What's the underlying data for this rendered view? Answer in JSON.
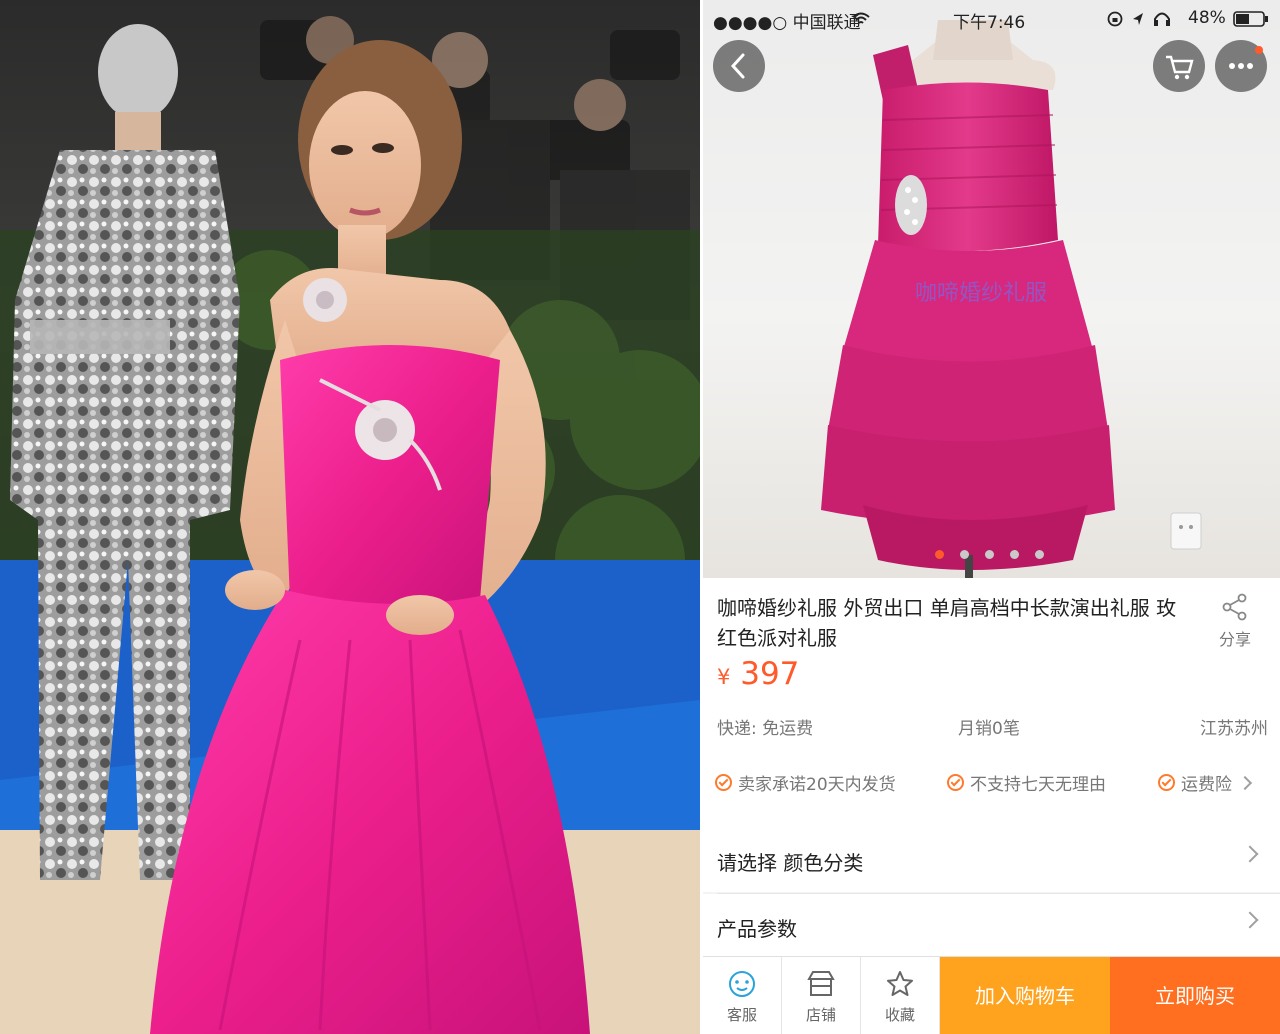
{
  "status_bar": {
    "carrier": "●●●●○ 中国联通",
    "time": "下午7:46",
    "battery": "48%",
    "icons": [
      "wifi-icon",
      "lock-rotation-icon",
      "location-icon",
      "headphones-icon",
      "battery-icon"
    ]
  },
  "product": {
    "watermark": "咖啼婚纱礼服",
    "title": "咖啼婚纱礼服 外贸出口 单肩高档中长款演出礼服 玫红色派对礼服",
    "share_label": "分享",
    "currency": "¥",
    "price": "397",
    "shipping": "快递: 免运费",
    "monthly_sales": "月销0笔",
    "location": "江苏苏州",
    "promises": [
      "卖家承诺20天内发货",
      "不支持七天无理由",
      "运费险"
    ],
    "image_dots": 5,
    "active_dot": 0
  },
  "rows": {
    "select": "请选择 颜色分类",
    "params": "产品参数"
  },
  "bottom_bar": {
    "service": "客服",
    "shop": "店铺",
    "favorite": "收藏",
    "add_to_cart": "加入购物车",
    "buy_now": "立即购买"
  },
  "colors": {
    "accent": "#ff5a2a",
    "cart_button": "#ffa21d",
    "buy_button": "#ff6f1f",
    "dress_pink": "#e9238f"
  }
}
